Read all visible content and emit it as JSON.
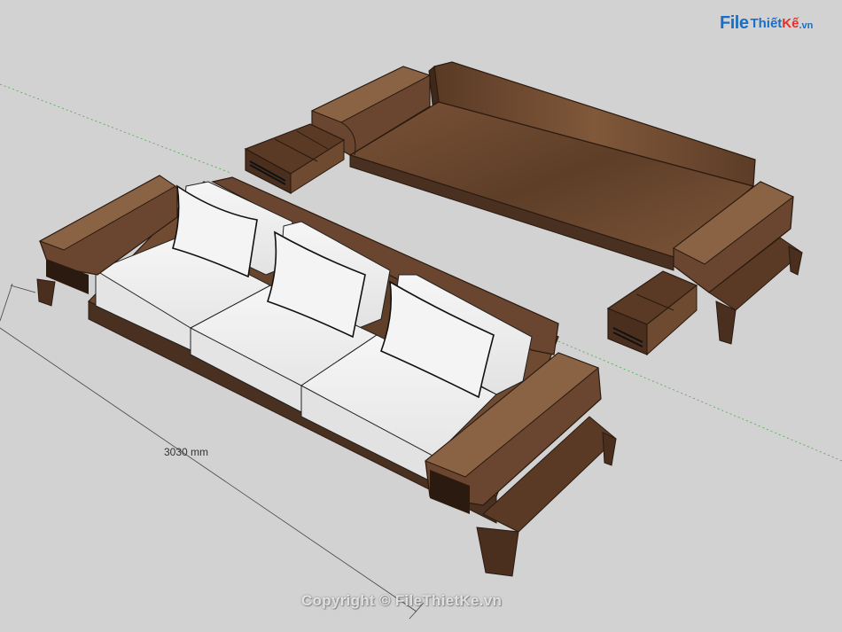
{
  "dimension": {
    "text": "3030 mm"
  },
  "logo": {
    "part1": "File",
    "part2": "Thiết",
    "part3": "Kế",
    "part4": ".vn"
  },
  "copyright": {
    "text": "Copyright © FileThietKe.vn"
  },
  "colors": {
    "background": "#d2d2d2",
    "wood": "#6e4a30",
    "wood_dark": "#4a3020",
    "wood_light": "#8a6244",
    "cushion": "#f2f2f2",
    "cushion_shadow": "#d8d8d8",
    "guide_line": "#4aa84a"
  }
}
